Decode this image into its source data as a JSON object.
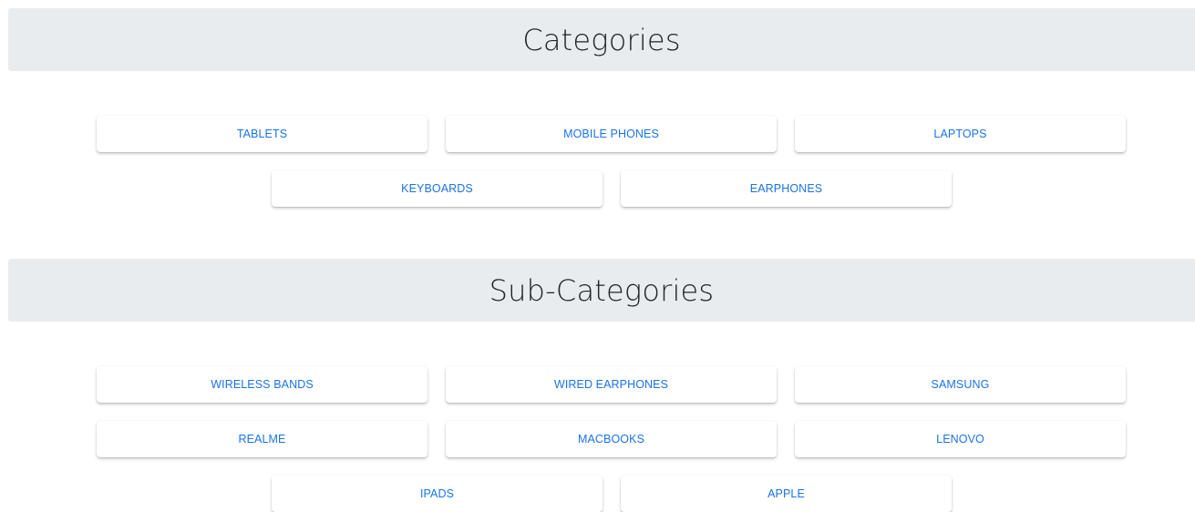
{
  "categories": {
    "title": "Categories",
    "items": [
      {
        "label": "TABLETS"
      },
      {
        "label": "MOBILE PHONES"
      },
      {
        "label": "LAPTOPS"
      },
      {
        "label": "KEYBOARDS"
      },
      {
        "label": "EARPHONES"
      }
    ]
  },
  "subcategories": {
    "title": "Sub-Categories",
    "items": [
      {
        "label": "WIRELESS BANDS"
      },
      {
        "label": "WIRED EARPHONES"
      },
      {
        "label": "SAMSUNG"
      },
      {
        "label": "REALME"
      },
      {
        "label": "MACBOOKS"
      },
      {
        "label": "LENOVO"
      },
      {
        "label": "IPADS"
      },
      {
        "label": "APPLE"
      }
    ]
  },
  "colors": {
    "header_bg": "#e9ecef",
    "button_text": "#1a73e8",
    "title_text": "#212529"
  }
}
